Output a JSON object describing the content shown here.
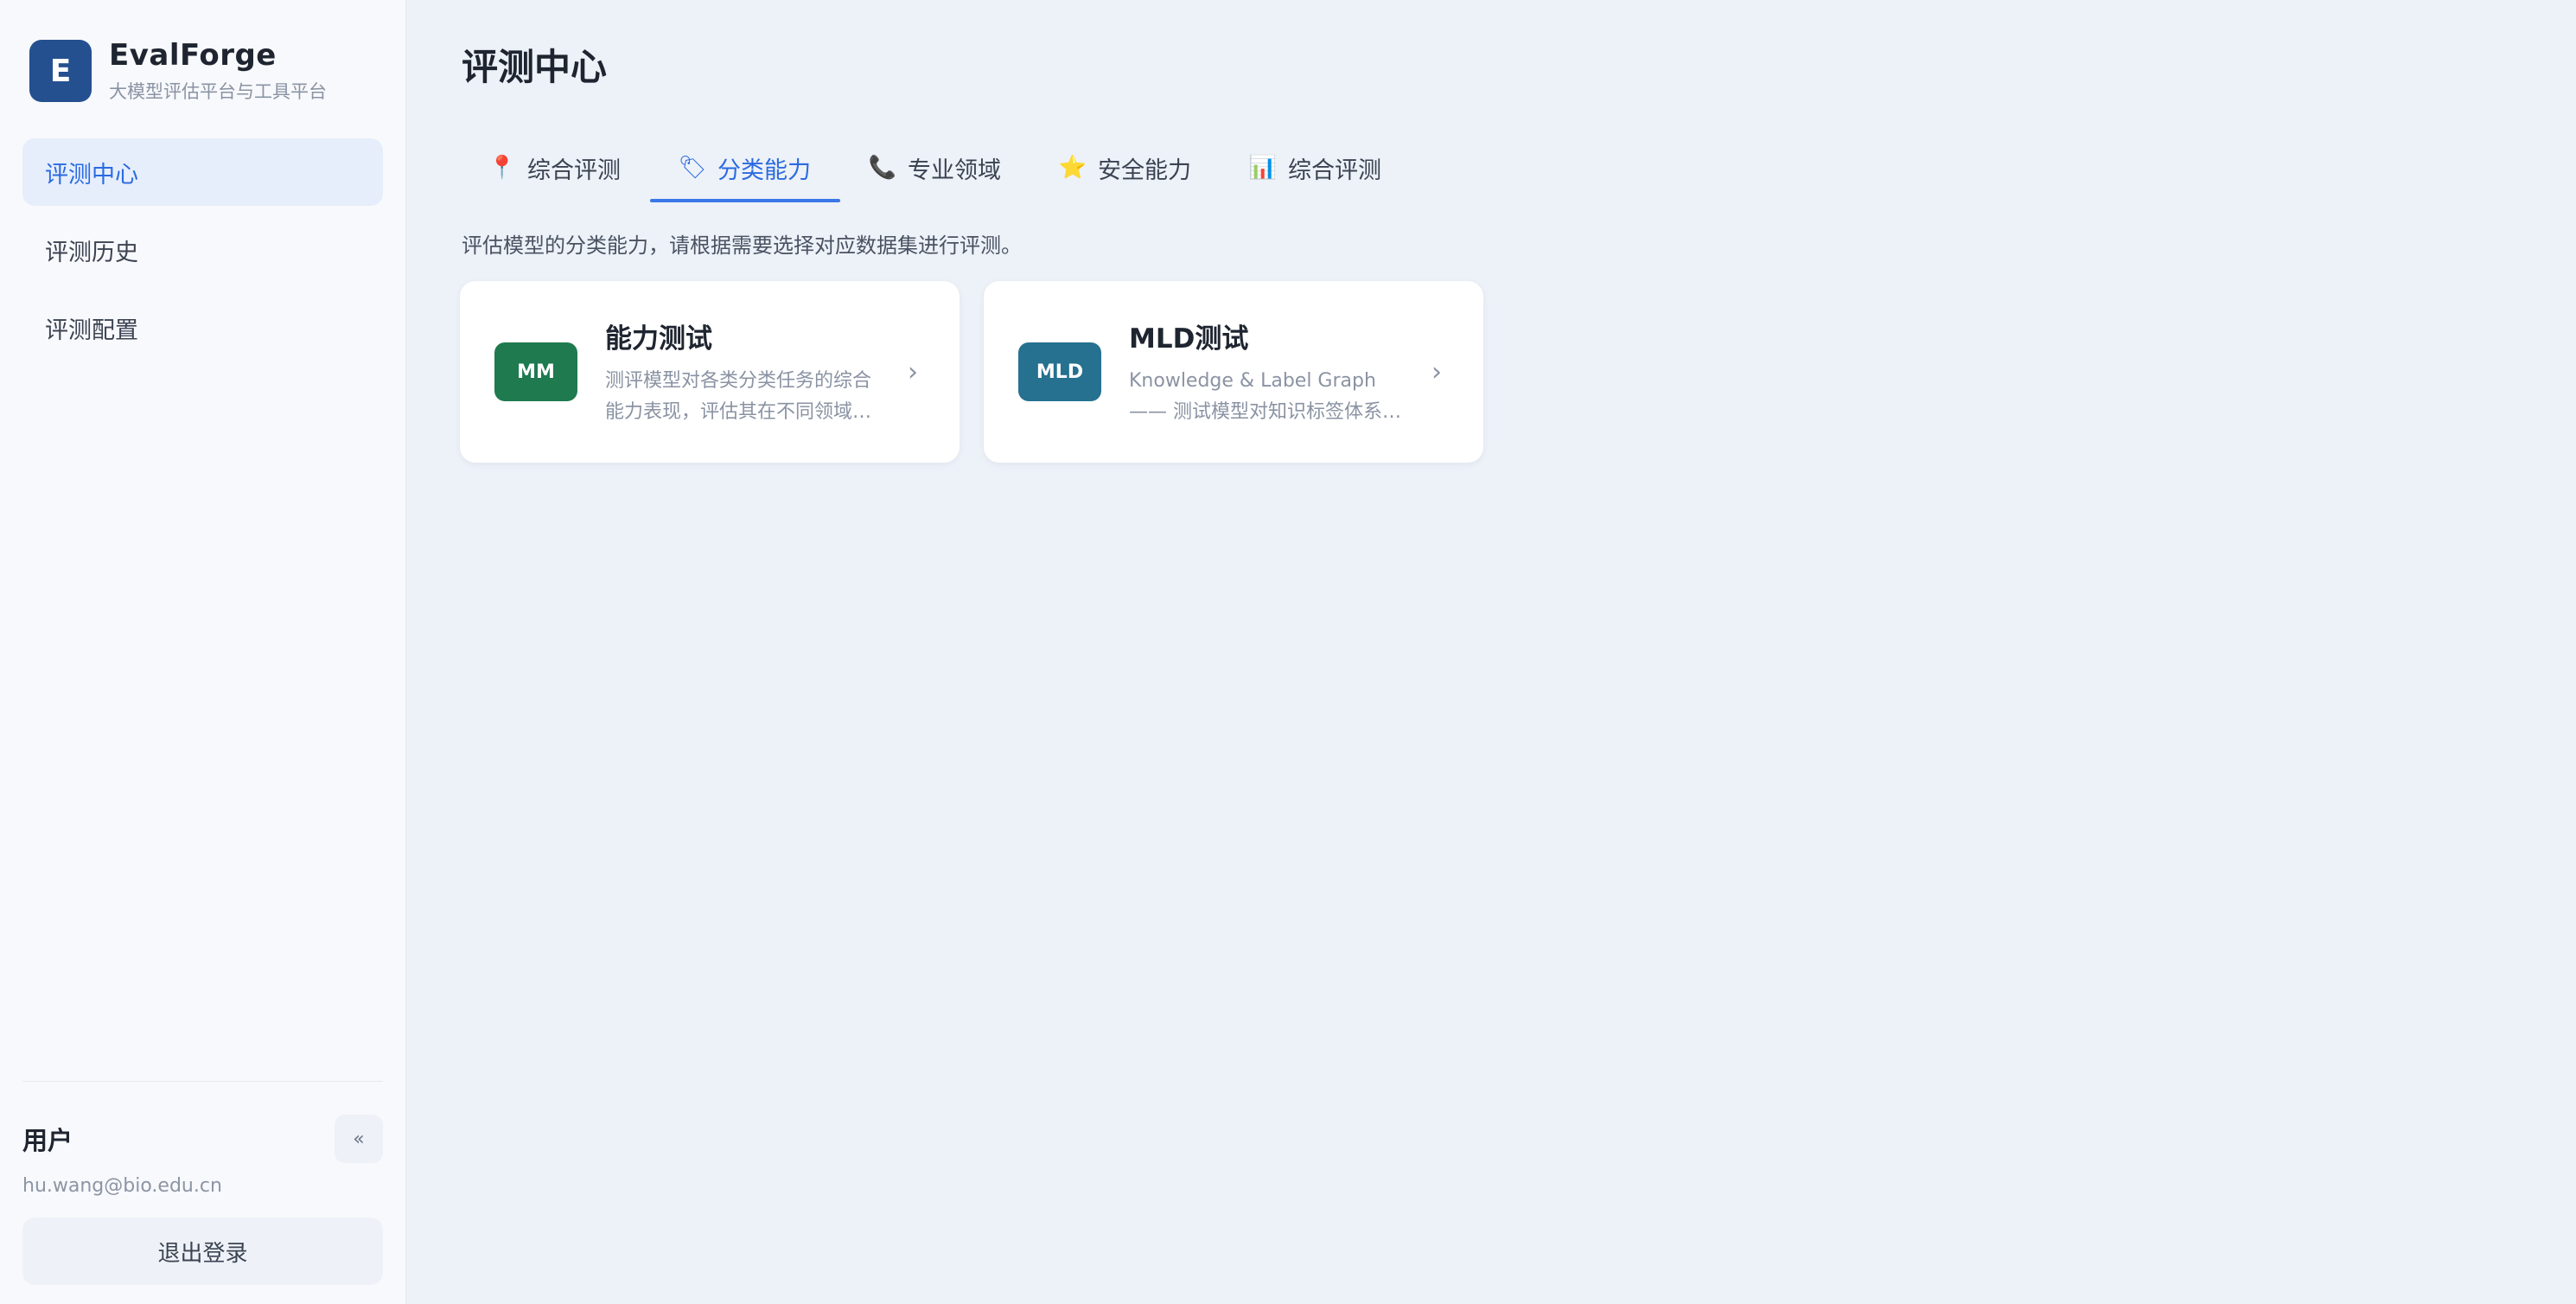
{
  "brand": {
    "logo_letter": "E",
    "name": "EvalForge",
    "subtitle": "大模型评估平台与工具平台",
    "logo_color": "#24508f"
  },
  "sidebar": {
    "items": [
      {
        "label": "评测中心",
        "active": true
      },
      {
        "label": "评测历史",
        "active": false
      },
      {
        "label": "评测配置",
        "active": false
      }
    ]
  },
  "user": {
    "name": "用户",
    "email": "hu.wang@bio.edu.cn",
    "logout_label": "退出登录",
    "collapse_glyph": "«"
  },
  "main": {
    "title": "评测中心",
    "tabs": [
      {
        "icon": "📍",
        "icon_name": "pin-icon",
        "label": "综合评测",
        "active": false
      },
      {
        "icon": "🏷",
        "icon_name": "tag-icon",
        "label": "分类能力",
        "active": true
      },
      {
        "icon": "📞",
        "icon_name": "phone-icon",
        "label": "专业领域",
        "active": false
      },
      {
        "icon": "⭐",
        "icon_name": "star-icon",
        "label": "安全能力",
        "active": false
      },
      {
        "icon": "📊",
        "icon_name": "chart-icon",
        "label": "综合评测",
        "active": false
      }
    ],
    "tab_description": "评估模型的分类能力，请根据需要选择对应数据集进行评测。",
    "cards": [
      {
        "badge": "MM",
        "badge_color": "#1f7a4f",
        "title": "能力测试",
        "description": "测评模型对各类分类任务的综合能力表现，评估其在不同领域分类任务中的准确率与稳定性。",
        "arrow": "›"
      },
      {
        "badge": "MLD",
        "badge_color": "#25718f",
        "title": "MLD测试",
        "description": "Knowledge & Label Graph —— 测试模型对知识标签体系的理解与分类能力。",
        "arrow": "›"
      }
    ]
  },
  "colors": {
    "accent": "#2b6be0",
    "background": "#edf1f8",
    "sidebar_bg": "#f8f9fc"
  }
}
